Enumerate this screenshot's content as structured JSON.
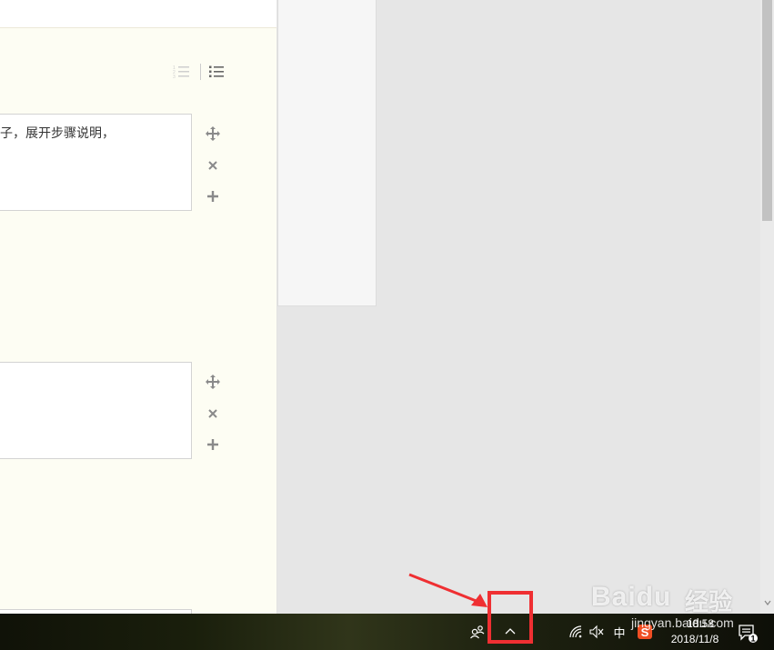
{
  "editor": {
    "step1_text": "子，展开步骤说明，",
    "step2_text": ""
  },
  "icons": {
    "ordered_list": "ordered-list-icon",
    "unordered_list": "unordered-list-icon",
    "move": "move-icon",
    "delete": "close-icon",
    "add": "plus-icon"
  },
  "taskbar": {
    "time": "18:58",
    "date": "2018/11/8",
    "notification_count": "1",
    "ime_label": "中",
    "sogou_label": "S"
  },
  "watermark": {
    "brand": "Baidu",
    "cn": "经验",
    "url": "jingyan.baidu.com"
  },
  "colors": {
    "highlight": "#ef2f32",
    "arrow": "#ef2f32",
    "editor_bg": "#fdfdf3"
  }
}
